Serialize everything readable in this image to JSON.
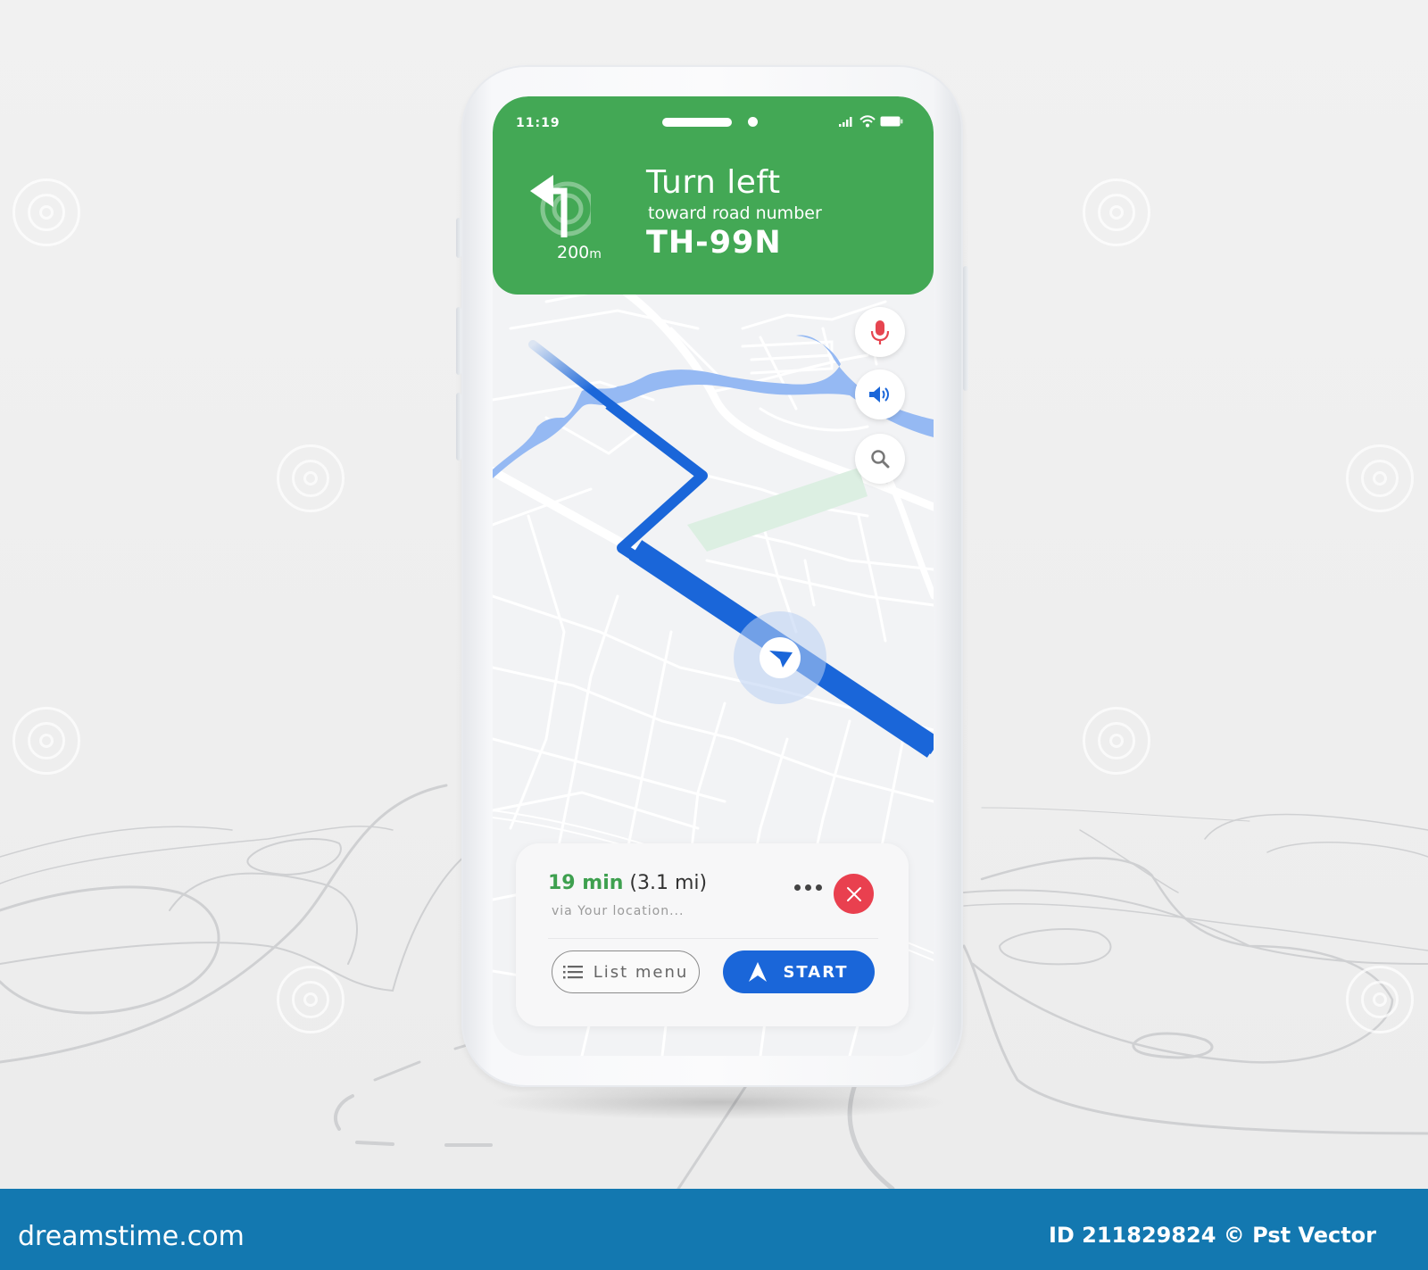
{
  "status_bar": {
    "time": "11:19",
    "icons": [
      "signal-icon",
      "wifi-icon",
      "battery-icon"
    ]
  },
  "navigation": {
    "maneuver_icon": "turn-left-arrow-icon",
    "distance_value": "200",
    "distance_unit": "m",
    "instruction": "Turn left",
    "subtitle": "toward road number",
    "road": "TH-99N"
  },
  "map_controls": [
    {
      "icon": "microphone-icon",
      "color": "#e64550"
    },
    {
      "icon": "speaker-icon",
      "color": "#1a66d9"
    },
    {
      "icon": "search-icon",
      "color": "#777777"
    }
  ],
  "route_card": {
    "eta_time": "19 min",
    "eta_distance": "(3.1 mi)",
    "via": "via Your location...",
    "more_icon": "more-horizontal-icon",
    "close_icon": "close-icon",
    "list_button": "List menu",
    "start_button": "START"
  },
  "colors": {
    "header_green": "#43a855",
    "route_blue": "#1a66d9",
    "water_blue": "#8fb5f2",
    "park_green": "#dcefe2",
    "close_red": "#e9404f",
    "footer_blue": "#1378b0"
  },
  "footer": {
    "brand": "dreamstime.com",
    "credit": "ID 211829824 © Pst Vector"
  }
}
